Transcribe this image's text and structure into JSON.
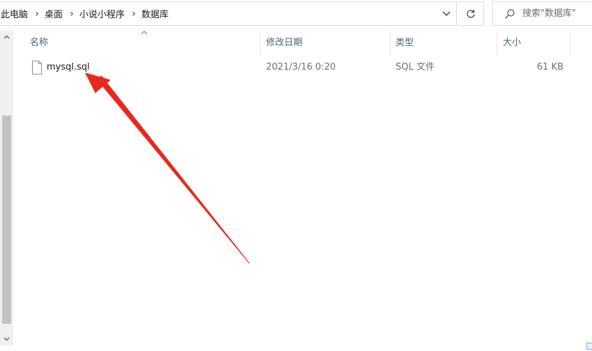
{
  "address_bar": {
    "crumbs": [
      "此电脑",
      "桌面",
      "小说小程序",
      "数据库"
    ]
  },
  "search": {
    "placeholder": "搜索\"数据库\""
  },
  "columns": {
    "name": "名称",
    "date_modified": "修改日期",
    "type": "类型",
    "size": "大小"
  },
  "files": [
    {
      "name": "mysql.sql",
      "date_modified": "2021/3/16 0:20",
      "type": "SQL 文件",
      "size": "61 KB"
    }
  ],
  "colors": {
    "annotation_arrow": "#e8281e",
    "header_text": "#4c607a",
    "scroll_thumb": "#c2c2c2"
  },
  "icons": [
    "chevron-right-icon",
    "chevron-down-icon",
    "refresh-icon",
    "search-icon",
    "sort-up-icon",
    "file-icon",
    "scroll-up-icon",
    "scroll-down-icon"
  ]
}
